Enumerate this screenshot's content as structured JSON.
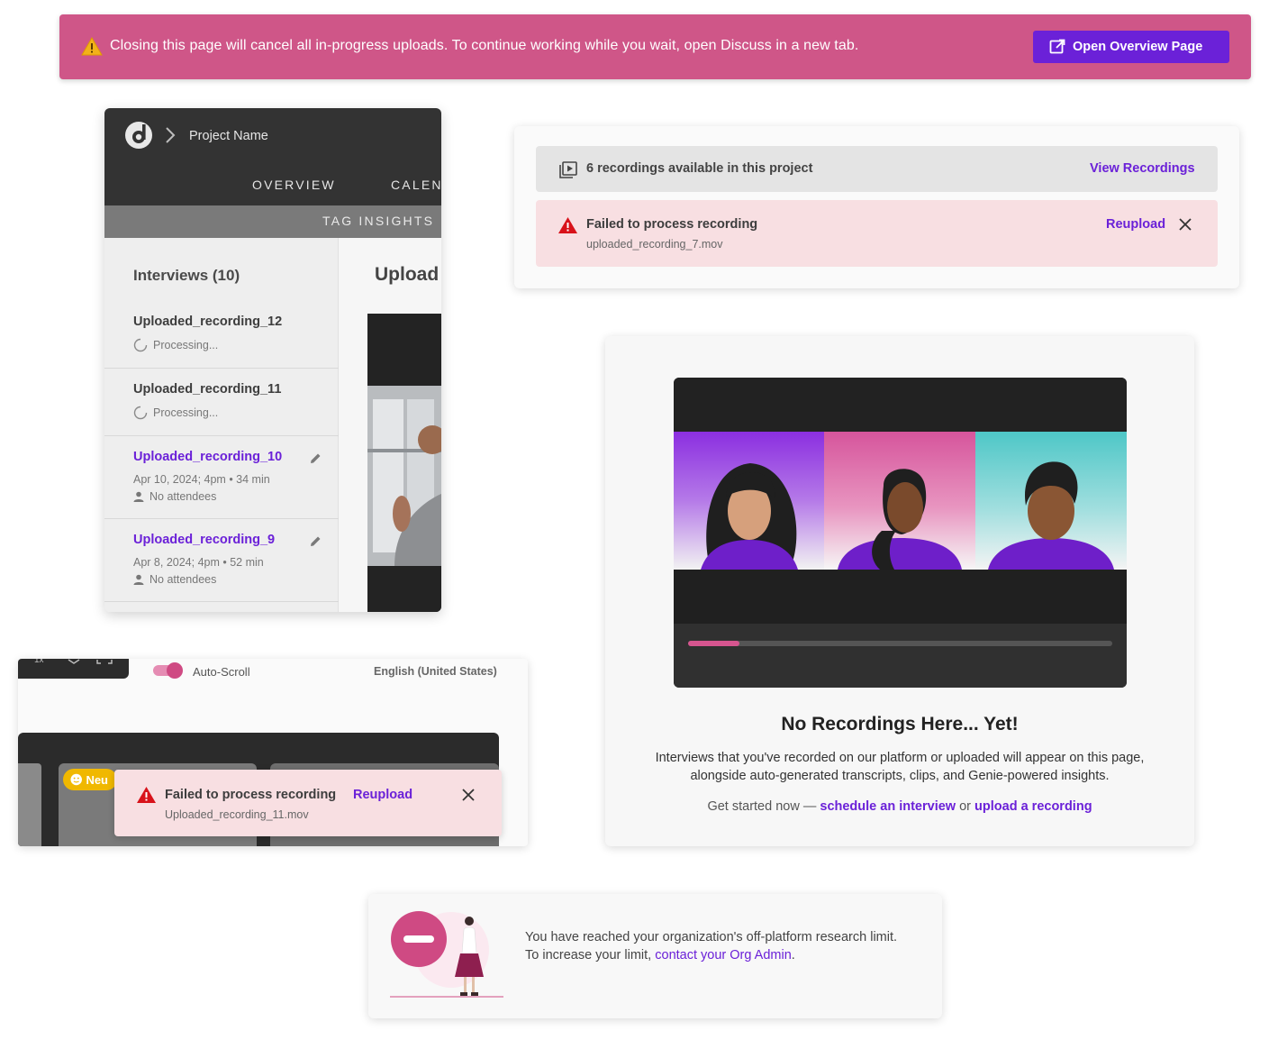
{
  "banner": {
    "message": "Closing this page will cancel all in-progress uploads. To continue working while you wait, open Discuss in a new tab.",
    "button_label": "Open Overview Page",
    "bg_color": "#cf5688",
    "button_color": "#6b21d8"
  },
  "project": {
    "name": "Project Name",
    "tabs": [
      "OVERVIEW",
      "CALEN"
    ],
    "subtab": "TAG INSIGHTS",
    "sidebar_title": "Interviews (10)",
    "main_title": "Upload",
    "recordings": [
      {
        "name": "Uploaded_recording_12",
        "status": "Processing..."
      },
      {
        "name": "Uploaded_recording_11",
        "status": "Processing..."
      },
      {
        "name": "Uploaded_recording_10",
        "meta": "Apr 10, 2024; 4pm • 34 min",
        "attendees": "No attendees"
      },
      {
        "name": "Uploaded_recording_9",
        "meta": "Apr 8, 2024; 4pm • 52 min",
        "attendees": "No attendees"
      }
    ]
  },
  "recordings_card": {
    "available_text": "6 recordings available in this project",
    "view_link": "View Recordings",
    "fail_title": "Failed to process recording",
    "fail_file": "uploaded_recording_7.mov",
    "reupload": "Reupload"
  },
  "transcript": {
    "auto_scroll": "Auto-Scroll",
    "auto_scroll_on": true,
    "language": "English (United States)",
    "sentiment": "Neu",
    "fail_title": "Failed to process recording",
    "fail_file": "Uploaded_recording_11.mov",
    "reupload": "Reupload"
  },
  "empty_state": {
    "title": "No Recordings Here... Yet!",
    "description": "Interviews that you've recorded on our platform or uploaded will appear on this page, alongside auto-generated transcripts, clips, and Genie-powered insights.",
    "cta_prefix": "Get started now — ",
    "schedule_link": "schedule an interview",
    "or_text": " or ",
    "upload_link": "upload a recording",
    "progress": 0.12
  },
  "limit": {
    "line1": "You have reached your organization's off-platform research limit.",
    "line2_prefix": "To increase your limit, ",
    "link": "contact your Org Admin",
    "line2_suffix": "."
  },
  "icons": {
    "warning": "warning-triangle-icon",
    "external": "open-external-icon",
    "video": "video-library-icon",
    "close": "close-icon",
    "edit": "pencil-icon",
    "person": "person-icon",
    "spinner": "spinner-icon"
  }
}
